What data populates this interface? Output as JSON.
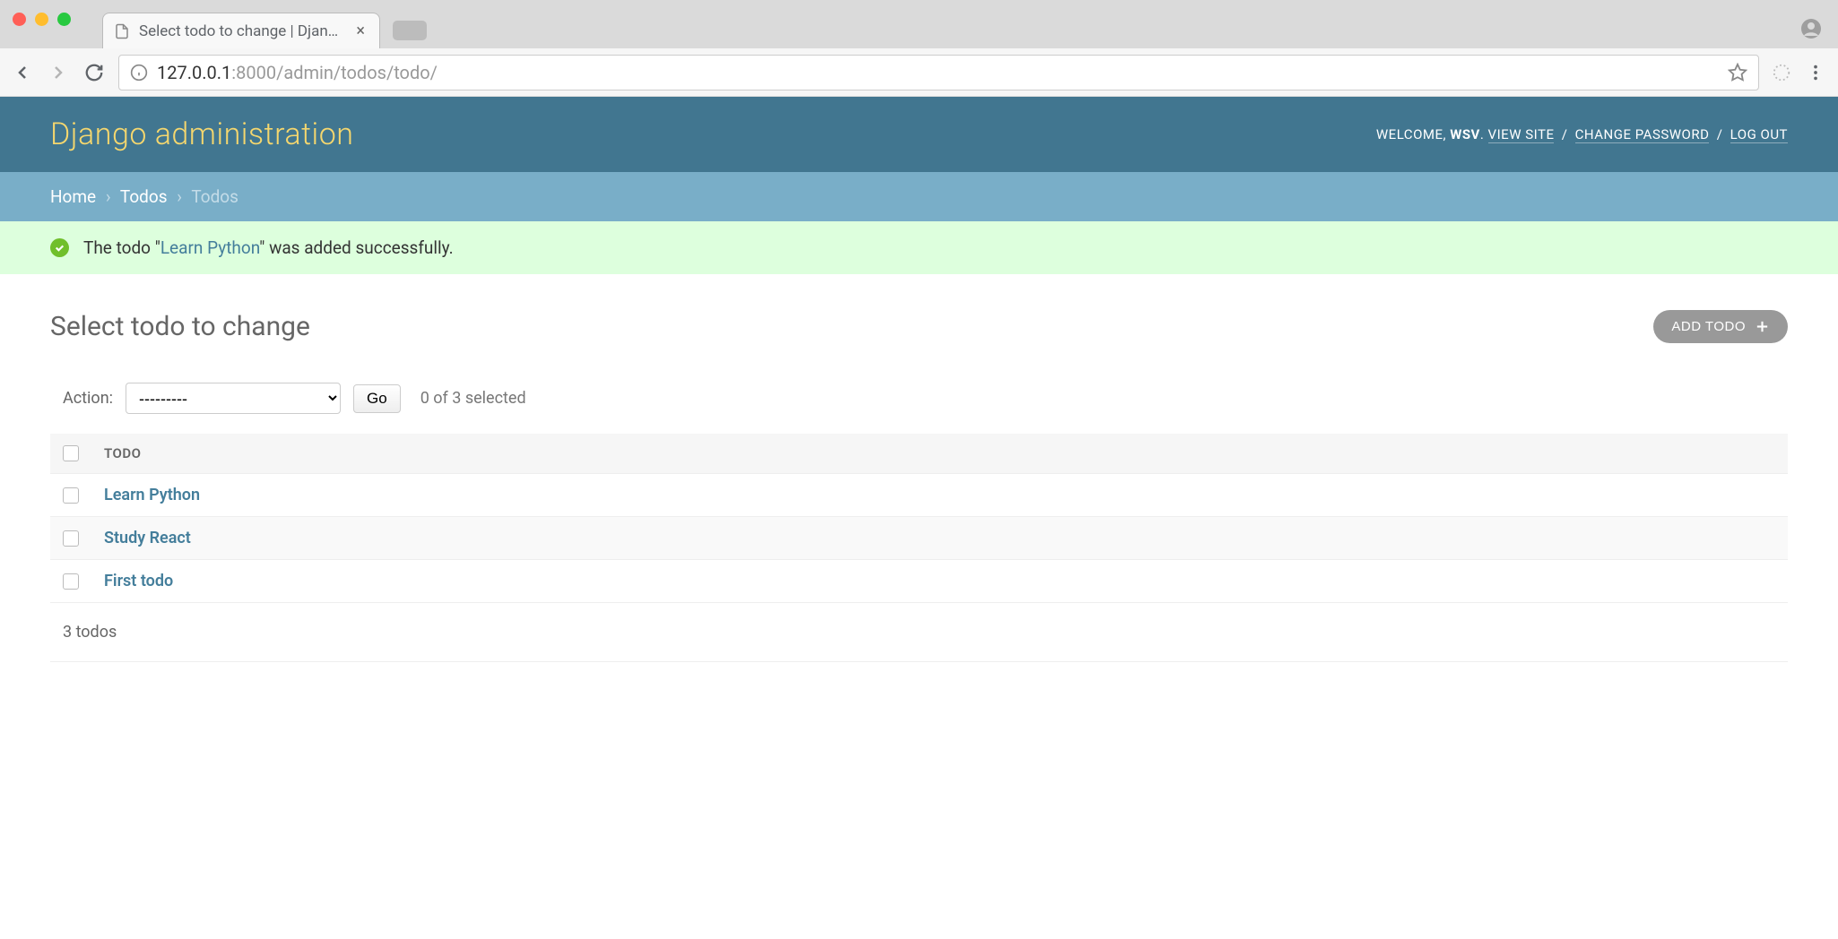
{
  "browser": {
    "tab_title": "Select todo to change | Djangc",
    "url_host": "127.0.0.1",
    "url_port_path": ":8000/admin/todos/todo/"
  },
  "header": {
    "site_title": "Django administration",
    "welcome": "WELCOME, ",
    "username": "WSV",
    "view_site": "VIEW SITE",
    "change_password": "CHANGE PASSWORD",
    "logout": "LOG OUT"
  },
  "breadcrumbs": {
    "home": "Home",
    "app": "Todos",
    "model": "Todos"
  },
  "message": {
    "prefix": "The todo \"",
    "object": "Learn Python",
    "suffix": "\" was added successfully."
  },
  "content": {
    "page_title": "Select todo to change",
    "add_button": "ADD TODO",
    "action_label": "Action:",
    "action_placeholder": "---------",
    "go_label": "Go",
    "selection_text": "0 of 3 selected",
    "column_header": "TODO",
    "rows": [
      {
        "title": "Learn Python"
      },
      {
        "title": "Study React"
      },
      {
        "title": "First todo"
      }
    ],
    "count_text": "3 todos"
  }
}
